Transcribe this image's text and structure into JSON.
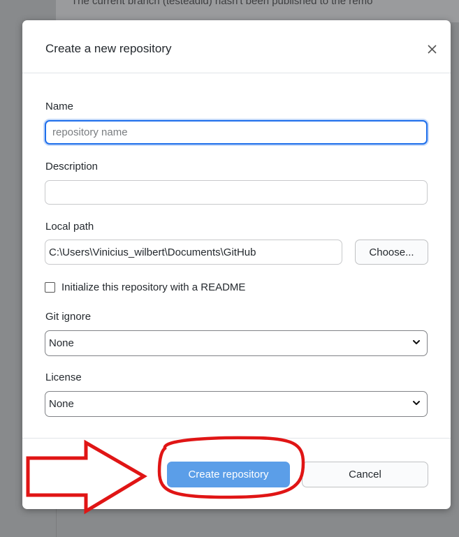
{
  "background": {
    "text": "The current branch (testeadld) hasn't been published to the remo"
  },
  "dialog": {
    "title": "Create a new repository",
    "close_icon": "close-icon"
  },
  "name": {
    "label": "Name",
    "placeholder": "repository name",
    "value": ""
  },
  "description": {
    "label": "Description",
    "value": ""
  },
  "local_path": {
    "label": "Local path",
    "value": "C:\\Users\\Vinicius_wilbert\\Documents\\GitHub",
    "choose_label": "Choose..."
  },
  "readme": {
    "label": "Initialize this repository with a README",
    "checked": false
  },
  "git_ignore": {
    "label": "Git ignore",
    "value": "None"
  },
  "license": {
    "label": "License",
    "value": "None"
  },
  "actions": {
    "create_label": "Create repository",
    "cancel_label": "Cancel"
  },
  "annotation": {
    "color": "#e01515",
    "shapes": [
      "arrow-right",
      "highlight-ellipse"
    ]
  },
  "colors": {
    "accent": "#1f6feb",
    "primary_button": "#5b9ee8"
  }
}
